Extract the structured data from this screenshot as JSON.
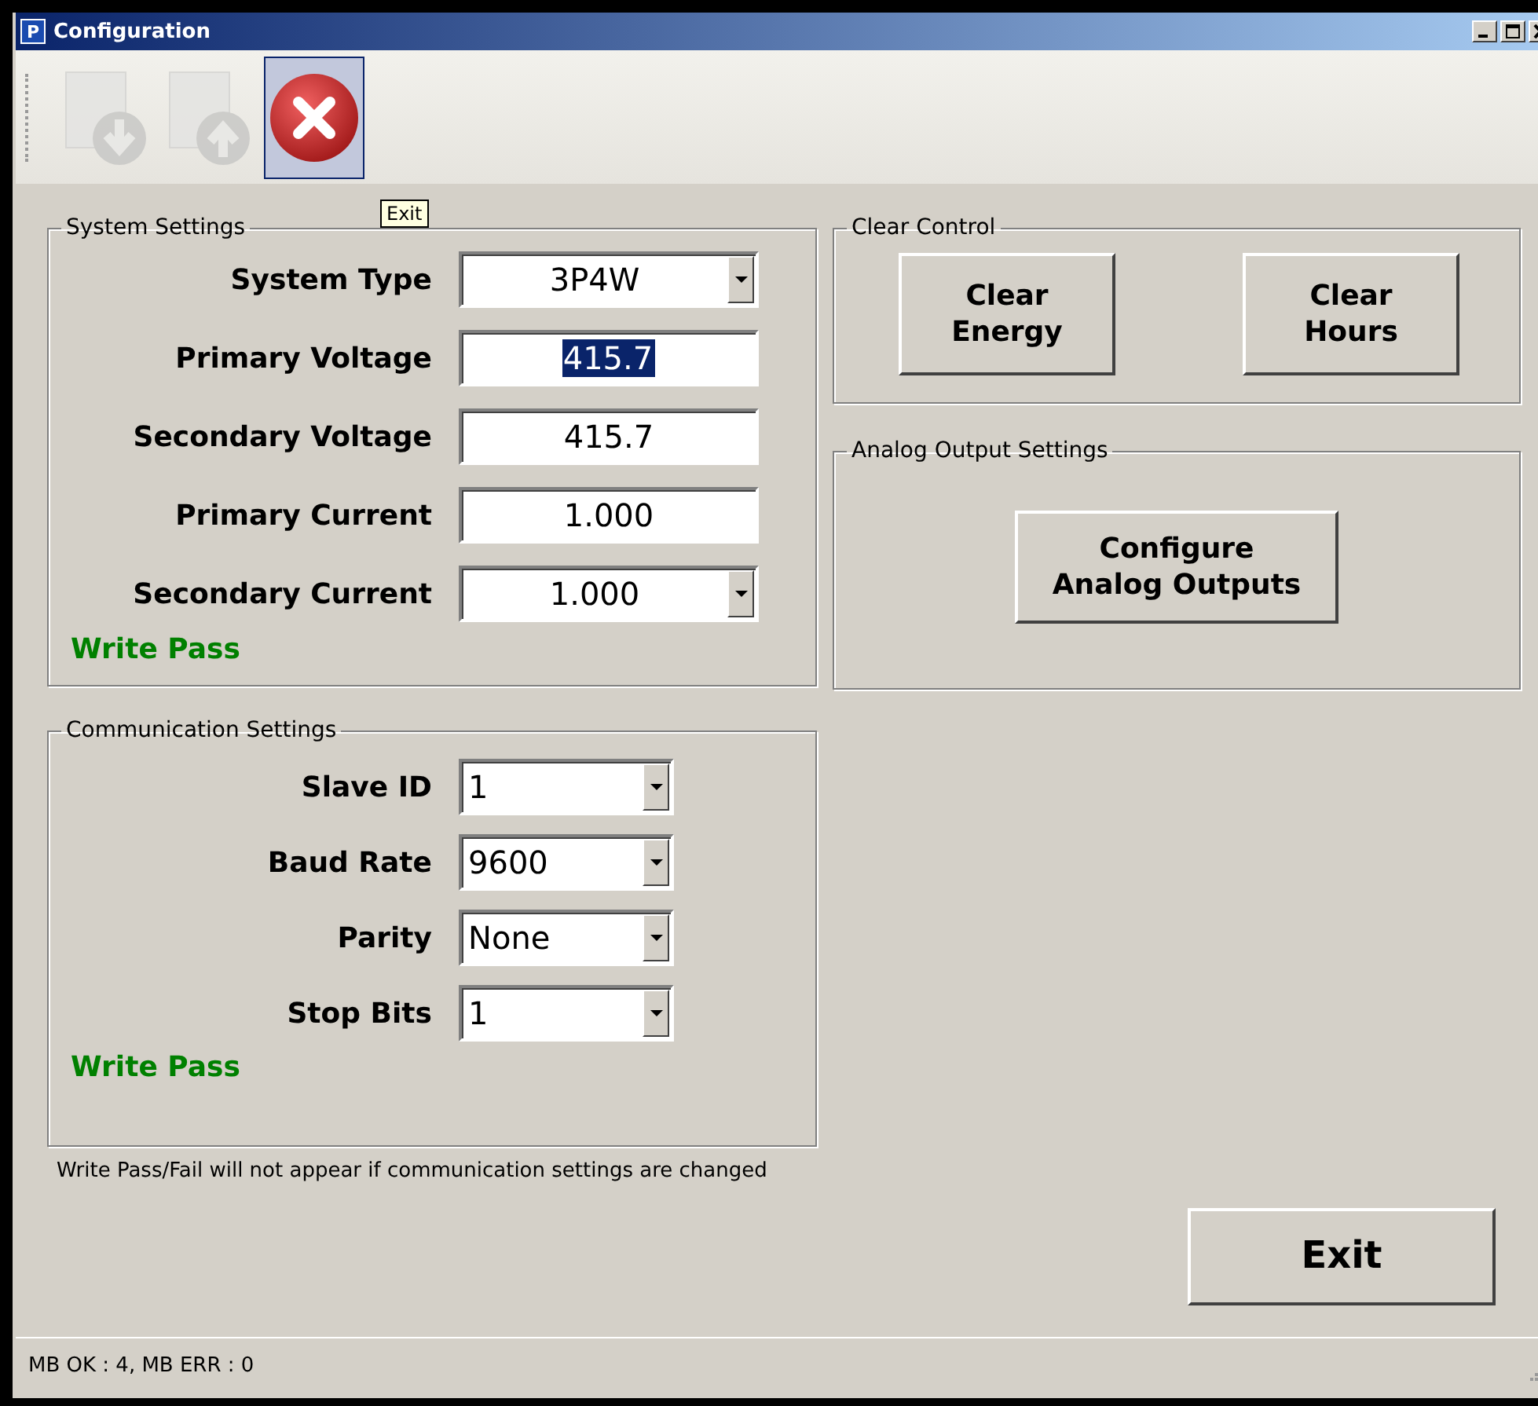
{
  "window": {
    "title": "Configuration",
    "app_icon_letter": "P"
  },
  "toolbar": {
    "buttons": [
      {
        "kind": "download",
        "disabled": true,
        "hovered": false
      },
      {
        "kind": "upload",
        "disabled": true,
        "hovered": false
      },
      {
        "kind": "exit",
        "disabled": false,
        "hovered": true
      }
    ],
    "tooltip": "Exit"
  },
  "system_settings": {
    "title": "System Settings",
    "fields": [
      {
        "label": "System Type",
        "kind": "dropdown",
        "value": "3P4W",
        "text_selected": false
      },
      {
        "label": "Primary Voltage",
        "kind": "text",
        "value": "415.7",
        "text_selected": true
      },
      {
        "label": "Secondary Voltage",
        "kind": "text",
        "value": "415.7",
        "text_selected": false
      },
      {
        "label": "Primary Current",
        "kind": "text",
        "value": "1.000",
        "text_selected": false
      },
      {
        "label": "Secondary Current",
        "kind": "dropdown",
        "value": "1.000",
        "text_selected": false
      }
    ],
    "status": "Write Pass"
  },
  "communication_settings": {
    "title": "Communication Settings",
    "fields": [
      {
        "label": "Slave ID",
        "kind": "dropdown",
        "value": "1"
      },
      {
        "label": "Baud Rate",
        "kind": "dropdown",
        "value": "9600"
      },
      {
        "label": "Parity",
        "kind": "dropdown",
        "value": "None"
      },
      {
        "label": "Stop Bits",
        "kind": "dropdown",
        "value": "1"
      }
    ],
    "status": "Write Pass"
  },
  "note": "Write Pass/Fail will not appear if communication settings are changed",
  "clear_control": {
    "title": "Clear Control",
    "buttons": [
      {
        "line1": "Clear",
        "line2": "Energy"
      },
      {
        "line1": "Clear",
        "line2": "Hours"
      }
    ]
  },
  "analog_output_settings": {
    "title": "Analog Output Settings",
    "button": {
      "line1": "Configure",
      "line2": "Analog Outputs"
    }
  },
  "exit_button": "Exit",
  "status_bar": "MB OK :  4, MB ERR :  0"
}
